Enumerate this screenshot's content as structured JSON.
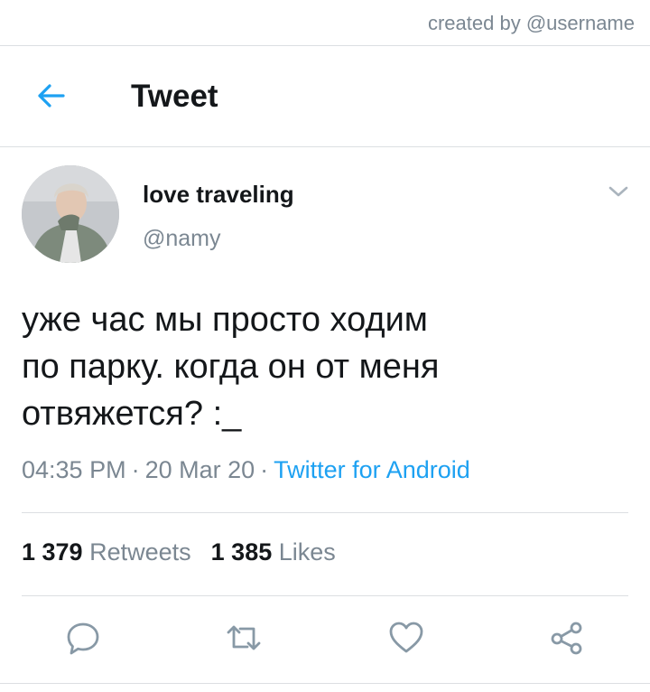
{
  "credit": "created by @username",
  "header": {
    "back_icon": "arrow-left-icon",
    "title": "Tweet"
  },
  "author": {
    "display_name": "love traveling",
    "handle": "@namy",
    "menu_icon": "chevron-down-icon"
  },
  "tweet": {
    "text": "уже час мы просто ходим\nпо парку. когда он от меня\nотвяжется? :_",
    "time": "04:35 PM",
    "date": "20 Mar 20",
    "separator": "·",
    "source": "Twitter for Android"
  },
  "stats": {
    "retweets_count": "1 379",
    "retweets_label": "Retweets",
    "likes_count": "1 385",
    "likes_label": "Likes"
  },
  "actions": [
    {
      "icon": "reply-icon"
    },
    {
      "icon": "retweet-icon"
    },
    {
      "icon": "heart-icon"
    },
    {
      "icon": "share-icon"
    }
  ],
  "colors": {
    "accent": "#1da1f2",
    "text": "#14171a",
    "secondary_text": "#7b8792",
    "divider": "#dcdfe2"
  }
}
